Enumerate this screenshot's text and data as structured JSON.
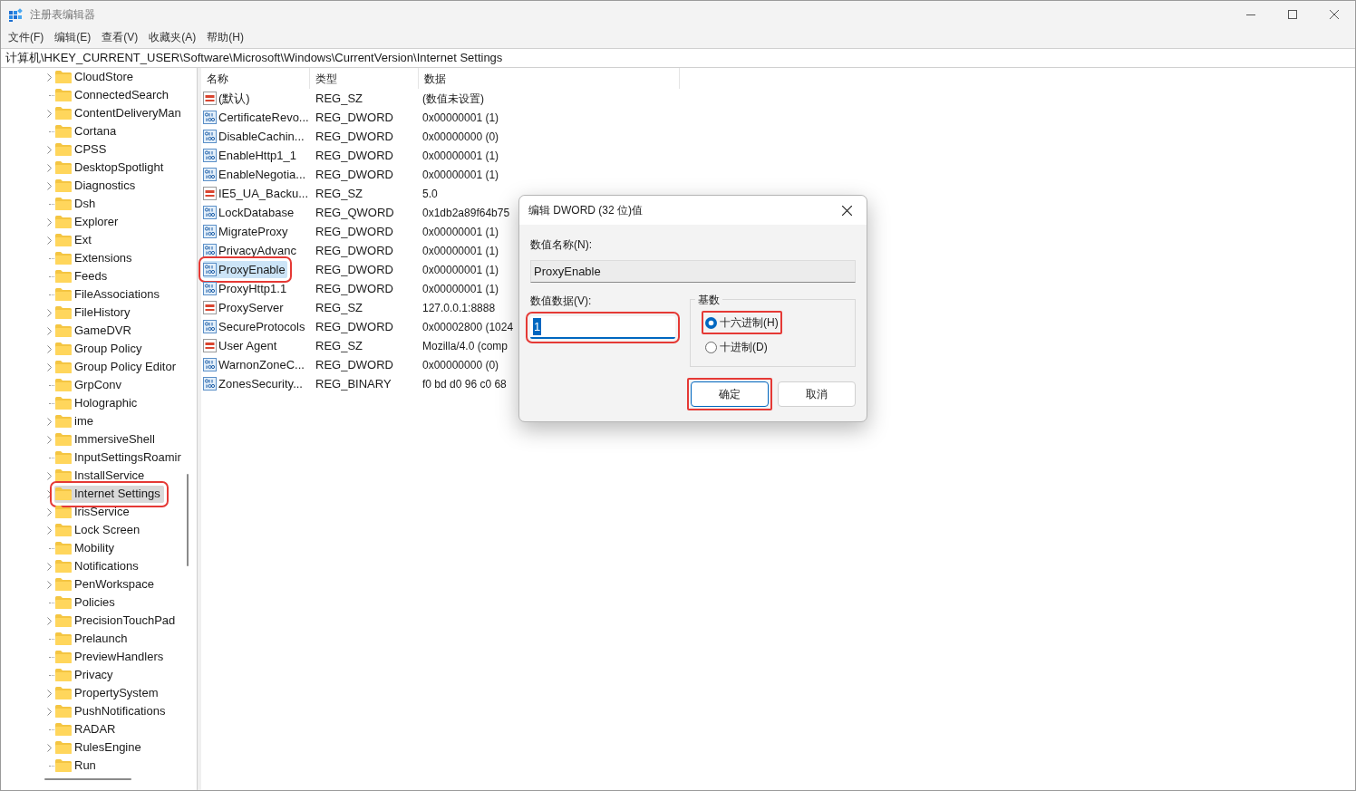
{
  "window": {
    "title": "注册表编辑器"
  },
  "menu": [
    "文件(F)",
    "编辑(E)",
    "查看(V)",
    "收藏夹(A)",
    "帮助(H)"
  ],
  "address": "计算机\\HKEY_CURRENT_USER\\Software\\Microsoft\\Windows\\CurrentVersion\\Internet Settings",
  "tree": [
    {
      "name": "CloudStore",
      "expandable": true,
      "selected": false,
      "annotated": false
    },
    {
      "name": "ConnectedSearch",
      "expandable": false,
      "selected": false,
      "annotated": false
    },
    {
      "name": "ContentDeliveryMan",
      "expandable": true,
      "selected": false,
      "annotated": false
    },
    {
      "name": "Cortana",
      "expandable": false,
      "selected": false,
      "annotated": false
    },
    {
      "name": "CPSS",
      "expandable": true,
      "selected": false,
      "annotated": false
    },
    {
      "name": "DesktopSpotlight",
      "expandable": true,
      "selected": false,
      "annotated": false
    },
    {
      "name": "Diagnostics",
      "expandable": true,
      "selected": false,
      "annotated": false
    },
    {
      "name": "Dsh",
      "expandable": false,
      "selected": false,
      "annotated": false
    },
    {
      "name": "Explorer",
      "expandable": true,
      "selected": false,
      "annotated": false
    },
    {
      "name": "Ext",
      "expandable": true,
      "selected": false,
      "annotated": false
    },
    {
      "name": "Extensions",
      "expandable": false,
      "selected": false,
      "annotated": false
    },
    {
      "name": "Feeds",
      "expandable": false,
      "selected": false,
      "annotated": false
    },
    {
      "name": "FileAssociations",
      "expandable": false,
      "selected": false,
      "annotated": false
    },
    {
      "name": "FileHistory",
      "expandable": true,
      "selected": false,
      "annotated": false
    },
    {
      "name": "GameDVR",
      "expandable": true,
      "selected": false,
      "annotated": false
    },
    {
      "name": "Group Policy",
      "expandable": true,
      "selected": false,
      "annotated": false
    },
    {
      "name": "Group Policy Editor",
      "expandable": true,
      "selected": false,
      "annotated": false
    },
    {
      "name": "GrpConv",
      "expandable": false,
      "selected": false,
      "annotated": false
    },
    {
      "name": "Holographic",
      "expandable": false,
      "selected": false,
      "annotated": false
    },
    {
      "name": "ime",
      "expandable": true,
      "selected": false,
      "annotated": false
    },
    {
      "name": "ImmersiveShell",
      "expandable": true,
      "selected": false,
      "annotated": false
    },
    {
      "name": "InputSettingsRoamir",
      "expandable": false,
      "selected": false,
      "annotated": false
    },
    {
      "name": "InstallService",
      "expandable": true,
      "selected": false,
      "annotated": false
    },
    {
      "name": "Internet Settings",
      "expandable": true,
      "selected": true,
      "annotated": true
    },
    {
      "name": "IrisService",
      "expandable": true,
      "selected": false,
      "annotated": false
    },
    {
      "name": "Lock Screen",
      "expandable": true,
      "selected": false,
      "annotated": false
    },
    {
      "name": "Mobility",
      "expandable": false,
      "selected": false,
      "annotated": false
    },
    {
      "name": "Notifications",
      "expandable": true,
      "selected": false,
      "annotated": false
    },
    {
      "name": "PenWorkspace",
      "expandable": true,
      "selected": false,
      "annotated": false
    },
    {
      "name": "Policies",
      "expandable": false,
      "selected": false,
      "annotated": false
    },
    {
      "name": "PrecisionTouchPad",
      "expandable": true,
      "selected": false,
      "annotated": false
    },
    {
      "name": "Prelaunch",
      "expandable": false,
      "selected": false,
      "annotated": false
    },
    {
      "name": "PreviewHandlers",
      "expandable": false,
      "selected": false,
      "annotated": false
    },
    {
      "name": "Privacy",
      "expandable": false,
      "selected": false,
      "annotated": false
    },
    {
      "name": "PropertySystem",
      "expandable": true,
      "selected": false,
      "annotated": false
    },
    {
      "name": "PushNotifications",
      "expandable": true,
      "selected": false,
      "annotated": false
    },
    {
      "name": "RADAR",
      "expandable": false,
      "selected": false,
      "annotated": false
    },
    {
      "name": "RulesEngine",
      "expandable": true,
      "selected": false,
      "annotated": false
    },
    {
      "name": "Run",
      "expandable": false,
      "selected": false,
      "annotated": false
    }
  ],
  "values": {
    "columns": [
      "名称",
      "类型",
      "数据"
    ],
    "rows": [
      {
        "kind": "string",
        "name": "(默认)",
        "type": "REG_SZ",
        "data": "(数值未设置)",
        "selected": false,
        "annotated": false
      },
      {
        "kind": "binary",
        "name": "CertificateRevo...",
        "type": "REG_DWORD",
        "data": "0x00000001 (1)",
        "selected": false,
        "annotated": false
      },
      {
        "kind": "binary",
        "name": "DisableCachin...",
        "type": "REG_DWORD",
        "data": "0x00000000 (0)",
        "selected": false,
        "annotated": false
      },
      {
        "kind": "binary",
        "name": "EnableHttp1_1",
        "type": "REG_DWORD",
        "data": "0x00000001 (1)",
        "selected": false,
        "annotated": false
      },
      {
        "kind": "binary",
        "name": "EnableNegotia...",
        "type": "REG_DWORD",
        "data": "0x00000001 (1)",
        "selected": false,
        "annotated": false
      },
      {
        "kind": "string",
        "name": "IE5_UA_Backu...",
        "type": "REG_SZ",
        "data": "5.0",
        "selected": false,
        "annotated": false
      },
      {
        "kind": "binary",
        "name": "LockDatabase",
        "type": "REG_QWORD",
        "data": "0x1db2a89f64b75",
        "selected": false,
        "annotated": false
      },
      {
        "kind": "binary",
        "name": "MigrateProxy",
        "type": "REG_DWORD",
        "data": "0x00000001 (1)",
        "selected": false,
        "annotated": false
      },
      {
        "kind": "binary",
        "name": "PrivacyAdvanc",
        "type": "REG_DWORD",
        "data": "0x00000001 (1)",
        "selected": false,
        "annotated": false
      },
      {
        "kind": "binary",
        "name": "ProxyEnable",
        "type": "REG_DWORD",
        "data": "0x00000001 (1)",
        "selected": true,
        "annotated": true
      },
      {
        "kind": "binary",
        "name": "ProxyHttp1.1",
        "type": "REG_DWORD",
        "data": "0x00000001 (1)",
        "selected": false,
        "annotated": false
      },
      {
        "kind": "string",
        "name": "ProxyServer",
        "type": "REG_SZ",
        "data": "127.0.0.1:8888",
        "selected": false,
        "annotated": false
      },
      {
        "kind": "binary",
        "name": "SecureProtocols",
        "type": "REG_DWORD",
        "data": "0x00002800 (1024",
        "selected": false,
        "annotated": false
      },
      {
        "kind": "string",
        "name": "User Agent",
        "type": "REG_SZ",
        "data": "Mozilla/4.0 (comp",
        "selected": false,
        "annotated": false
      },
      {
        "kind": "binary",
        "name": "WarnonZoneC...",
        "type": "REG_DWORD",
        "data": "0x00000000 (0)",
        "selected": false,
        "annotated": false
      },
      {
        "kind": "binary",
        "name": "ZonesSecurity...",
        "type": "REG_BINARY",
        "data": "f0 bd d0 96 c0 68",
        "selected": false,
        "annotated": false
      }
    ]
  },
  "dialog": {
    "title": "编辑 DWORD (32 位)值",
    "name_label": "数值名称(N):",
    "name_value": "ProxyEnable",
    "data_label": "数值数据(V):",
    "data_value": "1",
    "data_annotated": true,
    "base_label": "基数",
    "bases": [
      {
        "label": "十六进制(H)",
        "selected": true,
        "annotated": true
      },
      {
        "label": "十进制(D)",
        "selected": false,
        "annotated": false
      }
    ],
    "buttons": [
      {
        "label": "确定",
        "default": true,
        "annotated": true
      },
      {
        "label": "取消",
        "default": false,
        "annotated": false
      }
    ]
  }
}
